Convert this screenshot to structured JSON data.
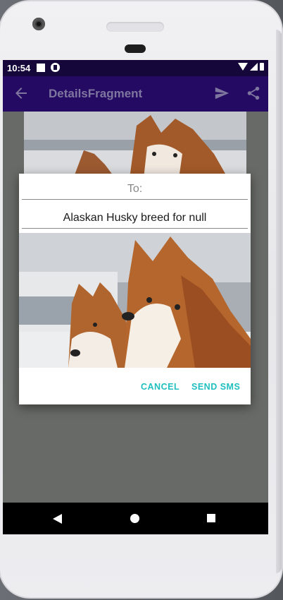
{
  "statusbar": {
    "time": "10:54"
  },
  "toolbar": {
    "title": "DetailsFragment"
  },
  "dialog": {
    "to_placeholder": "To:",
    "message_value": "Alaskan Husky breed for null",
    "cancel_label": "CANCEL",
    "send_label": "SEND SMS"
  },
  "colors": {
    "statusbar_bg": "#15073a",
    "toolbar_bg": "#240a62",
    "button_accent": "#1fbfc0",
    "scrim": "#686a67"
  },
  "icons": {
    "back": "arrow-left-icon",
    "send": "send-icon",
    "share": "share-icon"
  }
}
